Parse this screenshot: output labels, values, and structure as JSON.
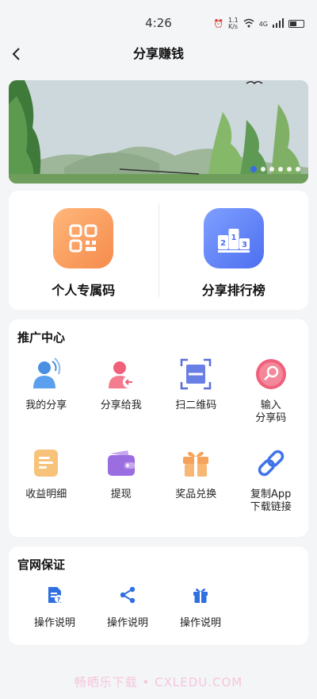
{
  "status": {
    "time": "4:26",
    "net_speed": "1.1\nK/s",
    "network": "4G"
  },
  "header": {
    "title": "分享赚钱"
  },
  "banner": {
    "dots": 6,
    "active_dot": 0
  },
  "top_actions": [
    {
      "label": "个人专属码",
      "icon": "qrcode-icon",
      "color": "#f58b4c"
    },
    {
      "label": "分享排行榜",
      "icon": "podium-icon",
      "color": "#4d6ff0"
    }
  ],
  "promo": {
    "title": "推广中心",
    "items": [
      {
        "label": "我的分享",
        "icon": "user-share-icon"
      },
      {
        "label": "分享给我",
        "icon": "user-receive-icon"
      },
      {
        "label": "扫二维码",
        "icon": "scan-icon"
      },
      {
        "label": "输入\n分享码",
        "icon": "search-code-icon"
      },
      {
        "label": "收益明细",
        "icon": "document-icon"
      },
      {
        "label": "提现",
        "icon": "wallet-icon"
      },
      {
        "label": "奖品兑换",
        "icon": "gift-icon"
      },
      {
        "label": "复制App\n下载链接",
        "icon": "link-icon"
      }
    ]
  },
  "guarantee": {
    "title": "官网保证",
    "items": [
      {
        "label": "操作说明",
        "icon": "help-doc-icon"
      },
      {
        "label": "操作说明",
        "icon": "share-icon"
      },
      {
        "label": "操作说明",
        "icon": "gift-icon"
      }
    ]
  },
  "watermark": "畅晒乐下载 • CXLEDU.COM"
}
